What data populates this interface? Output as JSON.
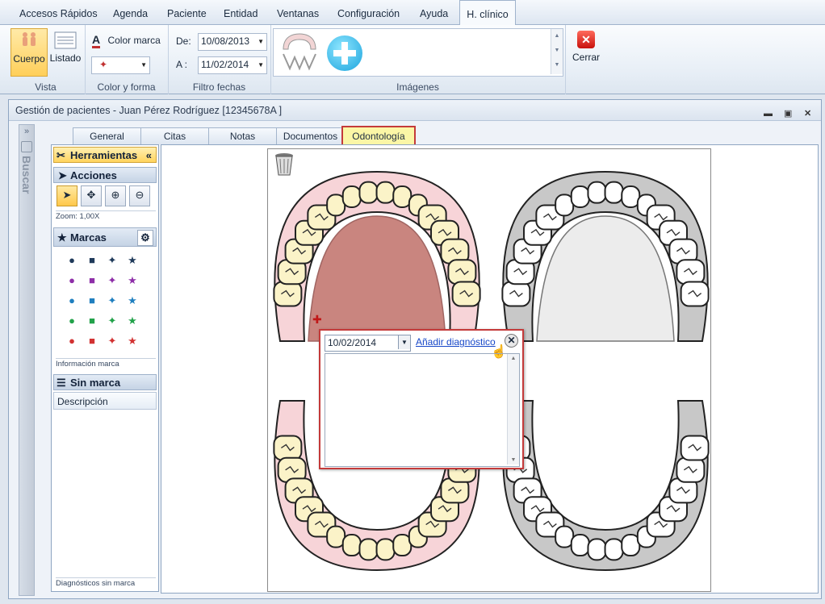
{
  "menu": {
    "tabs": [
      "Accesos Rápidos",
      "Agenda",
      "Paciente",
      "Entidad",
      "Ventanas",
      "Configuración",
      "Ayuda",
      "H. clínico"
    ]
  },
  "ribbon": {
    "vista": {
      "label": "Vista",
      "cuerpo": "Cuerpo",
      "listado": "Listado"
    },
    "color_forma": {
      "label": "Color y forma",
      "color_marca": "Color marca",
      "marker_symbol": "✦"
    },
    "filtro": {
      "label": "Filtro fechas",
      "de_label": "De:",
      "de_value": "10/08/2013",
      "a_label": "A :",
      "a_value": "11/02/2014"
    },
    "imagenes": {
      "label": "Imágenes"
    },
    "cerrar": {
      "label": "Cerrar"
    }
  },
  "document": {
    "title": "Gestión de pacientes - Juan Pérez Rodríguez  [12345678A ]",
    "buscar_label": "Buscar",
    "tabs": [
      "General",
      "Citas",
      "Notas",
      "Documentos",
      "Odontología"
    ],
    "active_tab": "Odontología"
  },
  "tools": {
    "header": "Herramientas",
    "acciones": "Acciones",
    "zoom": "Zoom: 1,00X",
    "marcas": "Marcas",
    "info_marca": "Información marca",
    "sin_marca": "Sin marca",
    "descripcion": "Descripción",
    "diag_sin_marca": "Diagnósticos sin marca",
    "mark_colors": [
      "#1f3a5a",
      "#8e2ea8",
      "#1f7fbf",
      "#22a24a",
      "#d23232"
    ]
  },
  "popup": {
    "date": "10/02/2014",
    "link": "Añadir diagnóstico"
  },
  "colors": {
    "accent_red": "#c43a3a",
    "active_tab_fill": "#fbf6a6"
  }
}
